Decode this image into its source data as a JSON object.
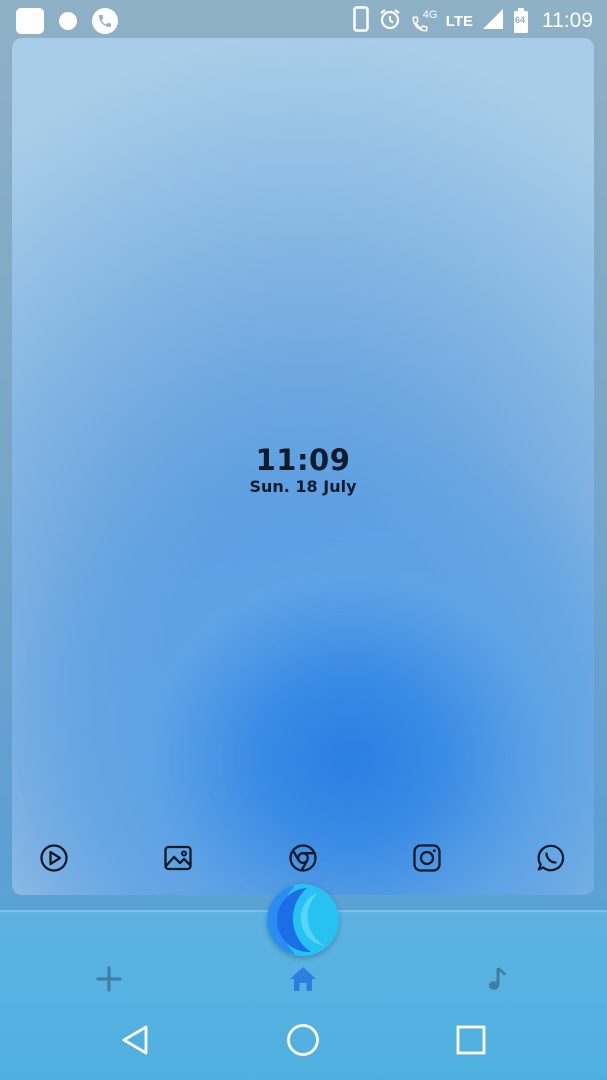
{
  "status_bar": {
    "time": "11:09",
    "network_label": "LTE",
    "call_network_label": "4G",
    "battery_level_label": "64",
    "left_icons": [
      "app-square-icon",
      "notification-dot-icon",
      "phone-call-icon"
    ],
    "right_icons": [
      "vibrate-phone-icon",
      "alarm-clock-icon",
      "wifi-calling-icon",
      "signal-icon",
      "battery-icon"
    ]
  },
  "lock_card": {
    "clock": "11:09",
    "date": "Sun. 18 July"
  },
  "dock": {
    "apps": [
      {
        "name": "play-store-icon"
      },
      {
        "name": "gallery-icon"
      },
      {
        "name": "chrome-icon"
      },
      {
        "name": "instagram-icon"
      },
      {
        "name": "whatsapp-icon"
      }
    ]
  },
  "bottom_bar": {
    "tabs": [
      {
        "name": "add-icon"
      },
      {
        "name": "home-icon",
        "active": true
      },
      {
        "name": "music-note-icon"
      }
    ],
    "active_color": "#2f7de1",
    "inactive_color": "#3f7fa6"
  },
  "nav_bar": {
    "buttons": [
      "back-icon",
      "home-circle-icon",
      "recents-icon"
    ]
  },
  "colors": {
    "card_center": "#2b7fe3",
    "card_top": "#a9cde9",
    "panel": "#55b1e0",
    "fab": "#27c2f2"
  }
}
